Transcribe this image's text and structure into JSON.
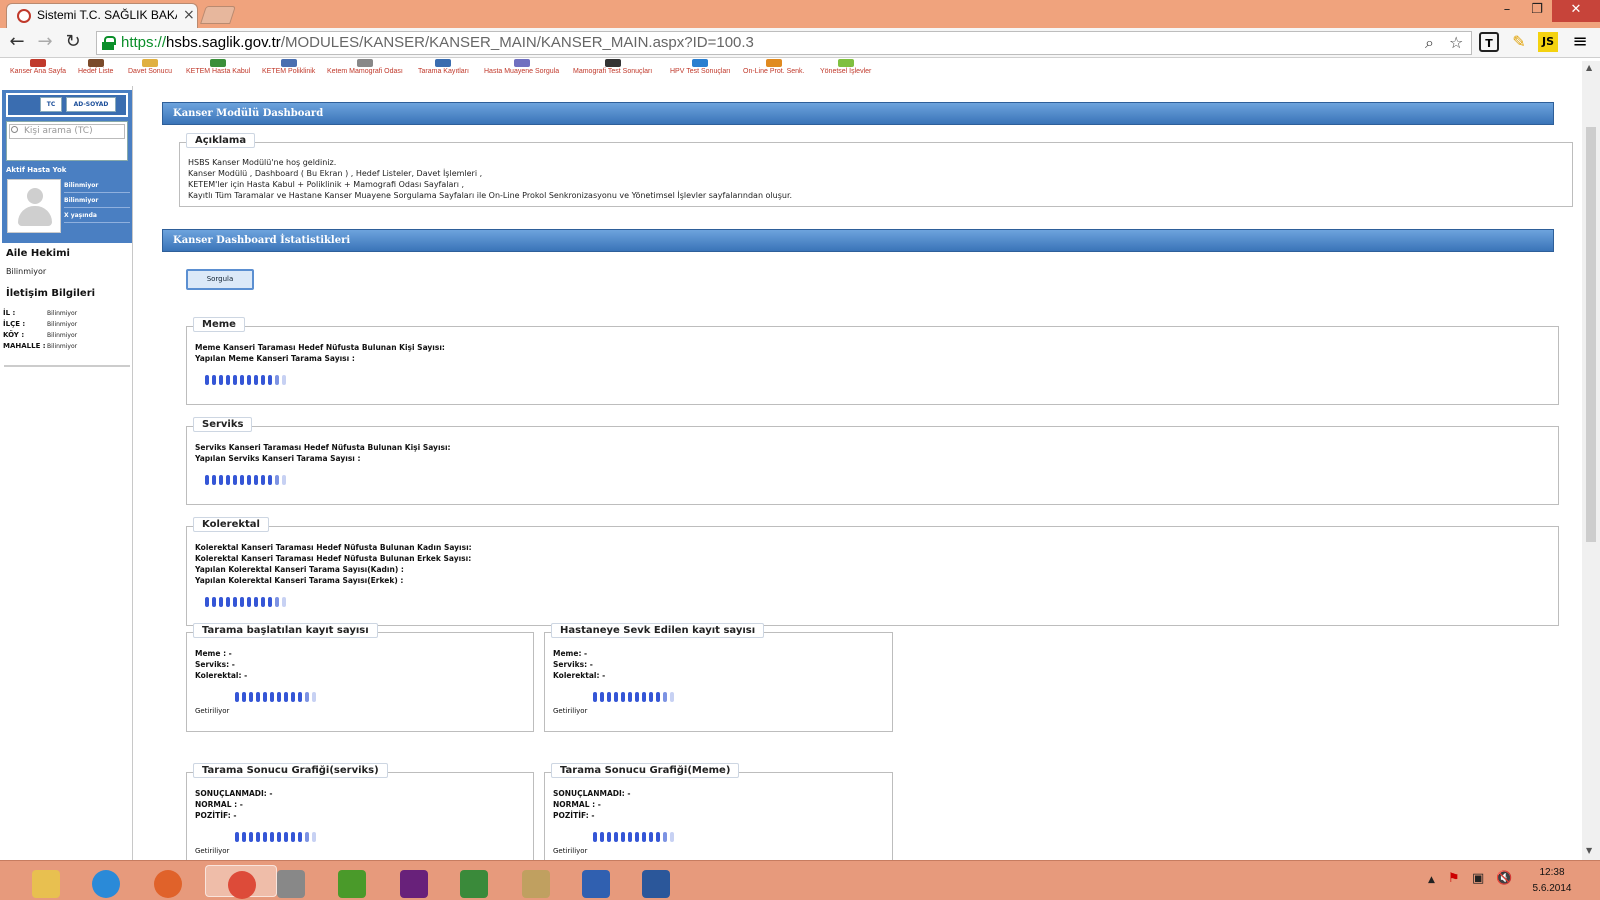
{
  "browser": {
    "tab_title": "Sistemi T.C. SAĞLIK BAKA",
    "tab_close": "×",
    "window_controls": {
      "minimize": "–",
      "maximize": "❐",
      "close": "✕"
    },
    "nav": {
      "back": "←",
      "forward": "→",
      "reload": "↻"
    },
    "url": {
      "scheme": "https://",
      "host": "hsbs.saglik.gov.tr",
      "path": "/MODULES/KANSER/KANSER_MAIN/KANSER_MAIN.aspx?ID=100.3"
    },
    "extensions": {
      "e1": "T",
      "e2": "✎",
      "e3": "JS",
      "menu": "≡"
    }
  },
  "module_menu": [
    {
      "label": "Kanser Ana Sayfa",
      "icon": "home-icon",
      "color": "#c0392b"
    },
    {
      "label": "Hedef Liste",
      "icon": "list-icon",
      "color": "#7a4a2a"
    },
    {
      "label": "Davet Sonucu",
      "icon": "envelope-icon",
      "color": "#e0b040"
    },
    {
      "label": "KETEM Hasta Kabul",
      "icon": "patient-icon",
      "color": "#3a8f3a"
    },
    {
      "label": "KETEM Poliklinik",
      "icon": "clinic-icon",
      "color": "#4a6fb0"
    },
    {
      "label": "Ketem Mamografi Odası",
      "icon": "xray-icon",
      "color": "#888888"
    },
    {
      "label": "Tarama Kayıtları",
      "icon": "records-icon",
      "color": "#3a6db0"
    },
    {
      "label": "Hasta Muayene Sorgula",
      "icon": "examine-icon",
      "color": "#7070c0"
    },
    {
      "label": "Mamografi Test Sonuçları",
      "icon": "mammo-icon",
      "color": "#333333"
    },
    {
      "label": "HPV Test Sonuçları",
      "icon": "globe-icon",
      "color": "#2a7fd0"
    },
    {
      "label": "On-Line Prot. Senk.",
      "icon": "sync-icon",
      "color": "#e08a20"
    },
    {
      "label": "Yönetsel İşlevler",
      "icon": "admin-icon",
      "color": "#80c040"
    }
  ],
  "sidebar": {
    "mode_tc": "TC",
    "mode_name": "AD-SOYAD",
    "search_placeholder": "Kişi arama (TC)",
    "active_patient": "Aktif Hasta Yok",
    "patient_fields": [
      "Bilinmiyor",
      "Bilinmiyor",
      "X yaşında"
    ],
    "family_doctor_title": "Aile Hekimi",
    "family_doctor_value": "Bilinmiyor",
    "contact_title": "İletişim Bilgileri",
    "address": [
      {
        "label": "İL :",
        "value": "Bilinmiyor"
      },
      {
        "label": "İLÇE :",
        "value": "Bilinmiyor"
      },
      {
        "label": "KÖY :",
        "value": "Bilinmiyor"
      },
      {
        "label": "MAHALLE :",
        "value": "Bilinmiyor"
      }
    ]
  },
  "main": {
    "dashboard_header": "Kanser Modülü Dashboard",
    "description": {
      "legend": "Açıklama",
      "lines": [
        "HSBS Kanser Modülü'ne hoş geldiniz.",
        "Kanser Modülü , Dashboard ( Bu Ekran ) , Hedef Listeler, Davet İşlemleri ,",
        "KETEM'ler için Hasta Kabul + Poliklinik + Mamografi Odası Sayfaları ,",
        "Kayıtlı Tüm Taramalar ve Hastane Kanser Muayene Sorgulama Sayfaları ile On-Line Prokol Senkronizasyonu ve Yönetimsel İşlevler sayfalarından oluşur."
      ]
    },
    "stats_header": "Kanser Dashboard İstatistikleri",
    "query_button": "Sorgula",
    "meme": {
      "legend": "Meme",
      "lines": [
        "Meme Kanseri Taraması Hedef Nüfusta Bulunan Kişi Sayısı:",
        "Yapılan Meme Kanseri Tarama Sayısı :"
      ]
    },
    "serviks": {
      "legend": "Serviks",
      "lines": [
        "Serviks Kanseri Taraması Hedef Nüfusta Bulunan Kişi Sayısı:",
        "Yapılan Serviks Kanseri Tarama Sayısı :"
      ]
    },
    "kolerektal": {
      "legend": "Kolerektal",
      "lines": [
        "Kolerektal Kanseri Taraması Hedef Nüfusta Bulunan Kadın Sayısı:",
        "Kolerektal Kanseri Taraması Hedef Nüfusta Bulunan Erkek Sayısı:",
        "Yapılan Kolerektal Kanseri Tarama Sayısı(Kadın) :",
        "Yapılan Kolerektal Kanseri Tarama Sayısı(Erkek) :"
      ]
    },
    "started": {
      "legend": "Tarama başlatılan kayıt sayısı",
      "lines": [
        "Meme : -",
        "Serviks: -",
        "Kolerektal: -"
      ],
      "status": "Getiriliyor"
    },
    "referred": {
      "legend": "Hastaneye Sevk Edilen kayıt sayısı",
      "lines": [
        "Meme: -",
        "Serviks: -",
        "Kolerektal: -"
      ],
      "status": "Getiriliyor"
    },
    "graph_serviks": {
      "legend": "Tarama Sonucu Grafiği(serviks)",
      "lines": [
        "SONUÇLANMADI: -",
        "NORMAL : -",
        "POZİTİF: -"
      ],
      "status": "Getiriliyor"
    },
    "graph_meme": {
      "legend": "Tarama Sonucu Grafiği(Meme)",
      "lines": [
        "SONUÇLANMADI: -",
        "NORMAL : -",
        "POZİTİF: -"
      ],
      "status": "Getiriliyor"
    }
  },
  "taskbar": {
    "apps": [
      {
        "name": "file-explorer-icon",
        "color": "#e8c050"
      },
      {
        "name": "internet-explorer-icon",
        "color": "#2a8ad8"
      },
      {
        "name": "firefox-icon",
        "color": "#e0622a"
      },
      {
        "name": "chrome-icon",
        "color": "#dd4b39"
      },
      {
        "name": "tools-icon",
        "color": "#888888"
      },
      {
        "name": "frog-icon",
        "color": "#4a9a2a"
      },
      {
        "name": "visual-studio-icon",
        "color": "#68217a"
      },
      {
        "name": "chart-editor-icon",
        "color": "#3a8a3a"
      },
      {
        "name": "paint-icon",
        "color": "#c0a060"
      },
      {
        "name": "remote-desktop-icon",
        "color": "#3060b0"
      },
      {
        "name": "word-icon",
        "color": "#2b579a"
      }
    ],
    "tray": {
      "show_hidden": "▲",
      "flag": "⚑",
      "network": "▣",
      "volume": "🔇"
    },
    "time": "12:38",
    "date": "5.6.2014"
  }
}
